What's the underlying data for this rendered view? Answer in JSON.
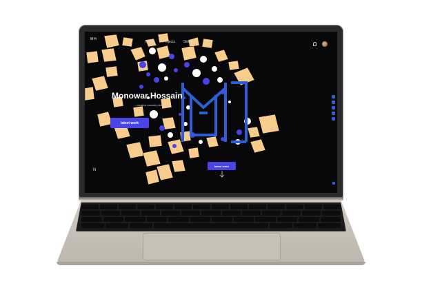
{
  "nav": {
    "logo": "MH",
    "links": [
      "Home",
      "Projects",
      "Skills"
    ]
  },
  "hero": {
    "name": "Monowar Hossain",
    "subtitle": "...creative security developer",
    "primary_button": "latest work",
    "secondary_button": "latest work",
    "footer_letter": "N"
  },
  "colors": {
    "accent": "#4a43e6",
    "shape_fill": "#f8cc8c",
    "logo_blue": "#2c5fd6",
    "background": "#08080a"
  },
  "icons": [
    "bell-icon",
    "avatar-icon",
    "github-icon",
    "linkedin-icon",
    "twitter-icon",
    "mail-icon",
    "scroll-indicator-icon",
    "arrow-down-icon"
  ]
}
